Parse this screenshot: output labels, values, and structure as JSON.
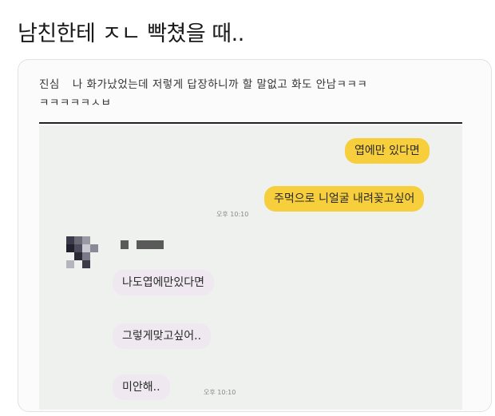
{
  "post": {
    "title": "남친한테 ㅈㄴ 빡쳤을 때.."
  },
  "caption": {
    "prefix": "진심",
    "line1": "나 화가났었는데 저렇게 답장하니까 할 말없고 화도 안남ㅋㅋㅋ",
    "line2": "ㅋㅋㅋㅋㅋㅅㅂ"
  },
  "chat": {
    "background": "#eef1ee",
    "my_bubble_color": "#f7cf3c",
    "their_bubble_color": "#efe8f0",
    "messages": [
      {
        "sender": "me",
        "text": "엽에만 있다면"
      },
      {
        "sender": "me",
        "text": "주먹으로 니얼굴 내려꽂고싶어",
        "time": "오후 10:10"
      },
      {
        "sender": "them",
        "text": "나도엽에만있다면"
      },
      {
        "sender": "them",
        "text": "그렇게맞고싶어.."
      },
      {
        "sender": "them",
        "text": "미안해..",
        "time": "오후 10:10"
      }
    ],
    "sender_name_icon": "censored-name-bar",
    "avatar_icon": "pixelated-avatar"
  }
}
